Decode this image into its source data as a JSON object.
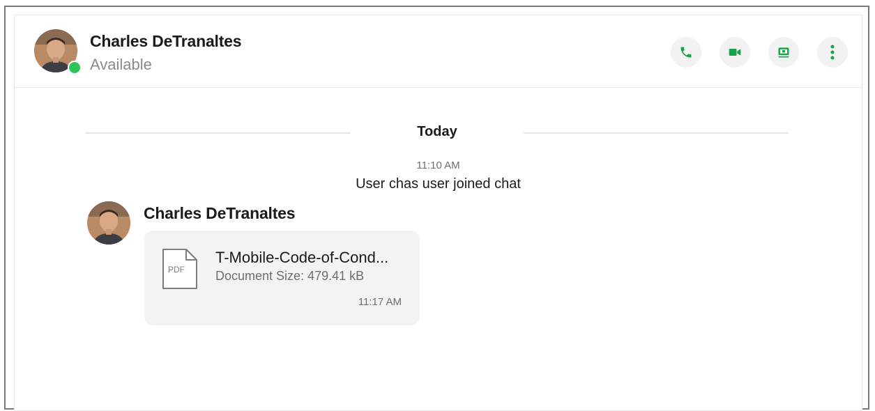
{
  "header": {
    "contact_name": "Charles DeTranaltes",
    "status": "Available",
    "status_color": "#2ec45a",
    "actions": [
      {
        "icon": "phone-icon"
      },
      {
        "icon": "video-camera-icon"
      },
      {
        "icon": "screen-share-icon"
      },
      {
        "icon": "more-vertical-icon"
      }
    ],
    "accent_color": "#1aa34a"
  },
  "conversation": {
    "day_divider": "Today",
    "system_message": {
      "time": "11:10 AM",
      "text": "User chas user joined chat"
    },
    "messages": [
      {
        "sender": "Charles DeTranaltes",
        "attachment": {
          "type_label": "PDF",
          "file_name": "T-Mobile-Code-of-Cond...",
          "size_text": "Document Size: 479.41 kB",
          "time": "11:17 AM"
        }
      }
    ]
  }
}
